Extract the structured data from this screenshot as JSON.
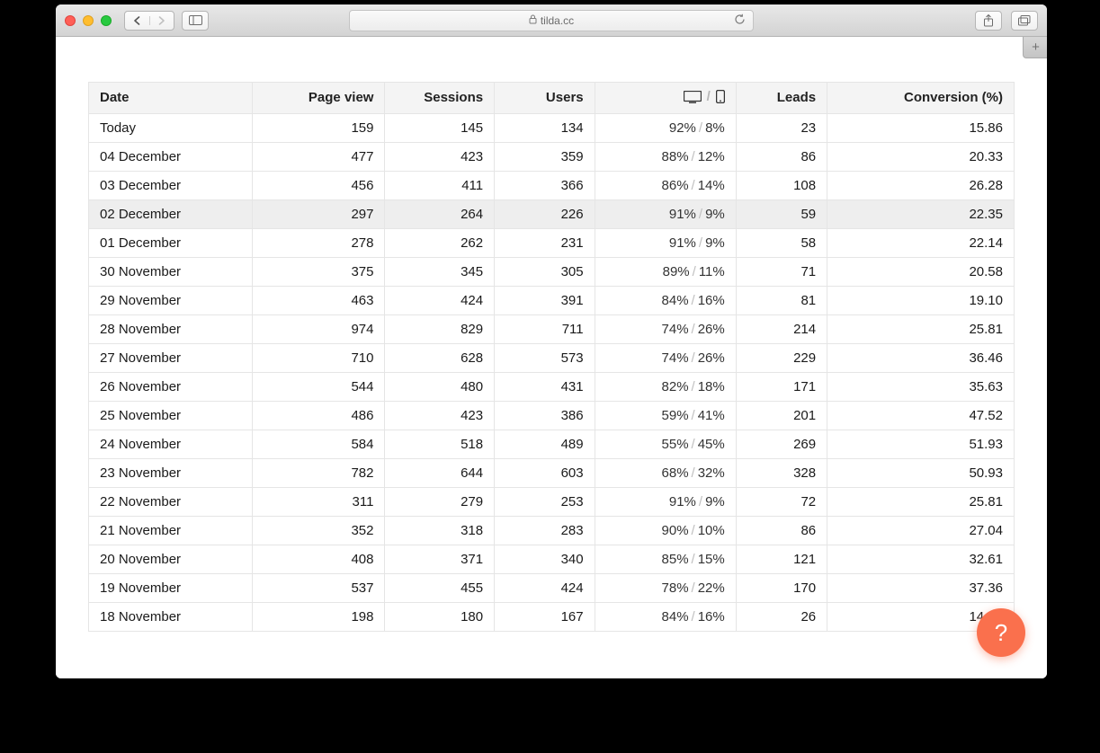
{
  "browser": {
    "url_host": "tilda.cc"
  },
  "table": {
    "headers": {
      "date": "Date",
      "page_view": "Page view",
      "sessions": "Sessions",
      "users": "Users",
      "leads": "Leads",
      "conversion": "Conversion (%)"
    },
    "rows": [
      {
        "date": "Today",
        "pv": "159",
        "sessions": "145",
        "users": "134",
        "desk": "92%",
        "mob": "8%",
        "leads": "23",
        "conv": "15.86",
        "hl": false
      },
      {
        "date": "04 December",
        "pv": "477",
        "sessions": "423",
        "users": "359",
        "desk": "88%",
        "mob": "12%",
        "leads": "86",
        "conv": "20.33",
        "hl": false
      },
      {
        "date": "03 December",
        "pv": "456",
        "sessions": "411",
        "users": "366",
        "desk": "86%",
        "mob": "14%",
        "leads": "108",
        "conv": "26.28",
        "hl": false
      },
      {
        "date": "02 December",
        "pv": "297",
        "sessions": "264",
        "users": "226",
        "desk": "91%",
        "mob": "9%",
        "leads": "59",
        "conv": "22.35",
        "hl": true
      },
      {
        "date": "01 December",
        "pv": "278",
        "sessions": "262",
        "users": "231",
        "desk": "91%",
        "mob": "9%",
        "leads": "58",
        "conv": "22.14",
        "hl": false
      },
      {
        "date": "30 November",
        "pv": "375",
        "sessions": "345",
        "users": "305",
        "desk": "89%",
        "mob": "11%",
        "leads": "71",
        "conv": "20.58",
        "hl": false
      },
      {
        "date": "29 November",
        "pv": "463",
        "sessions": "424",
        "users": "391",
        "desk": "84%",
        "mob": "16%",
        "leads": "81",
        "conv": "19.10",
        "hl": false
      },
      {
        "date": "28 November",
        "pv": "974",
        "sessions": "829",
        "users": "711",
        "desk": "74%",
        "mob": "26%",
        "leads": "214",
        "conv": "25.81",
        "hl": false
      },
      {
        "date": "27 November",
        "pv": "710",
        "sessions": "628",
        "users": "573",
        "desk": "74%",
        "mob": "26%",
        "leads": "229",
        "conv": "36.46",
        "hl": false
      },
      {
        "date": "26 November",
        "pv": "544",
        "sessions": "480",
        "users": "431",
        "desk": "82%",
        "mob": "18%",
        "leads": "171",
        "conv": "35.63",
        "hl": false
      },
      {
        "date": "25 November",
        "pv": "486",
        "sessions": "423",
        "users": "386",
        "desk": "59%",
        "mob": "41%",
        "leads": "201",
        "conv": "47.52",
        "hl": false
      },
      {
        "date": "24 November",
        "pv": "584",
        "sessions": "518",
        "users": "489",
        "desk": "55%",
        "mob": "45%",
        "leads": "269",
        "conv": "51.93",
        "hl": false
      },
      {
        "date": "23 November",
        "pv": "782",
        "sessions": "644",
        "users": "603",
        "desk": "68%",
        "mob": "32%",
        "leads": "328",
        "conv": "50.93",
        "hl": false
      },
      {
        "date": "22 November",
        "pv": "311",
        "sessions": "279",
        "users": "253",
        "desk": "91%",
        "mob": "9%",
        "leads": "72",
        "conv": "25.81",
        "hl": false
      },
      {
        "date": "21 November",
        "pv": "352",
        "sessions": "318",
        "users": "283",
        "desk": "90%",
        "mob": "10%",
        "leads": "86",
        "conv": "27.04",
        "hl": false
      },
      {
        "date": "20 November",
        "pv": "408",
        "sessions": "371",
        "users": "340",
        "desk": "85%",
        "mob": "15%",
        "leads": "121",
        "conv": "32.61",
        "hl": false
      },
      {
        "date": "19 November",
        "pv": "537",
        "sessions": "455",
        "users": "424",
        "desk": "78%",
        "mob": "22%",
        "leads": "170",
        "conv": "37.36",
        "hl": false
      },
      {
        "date": "18 November",
        "pv": "198",
        "sessions": "180",
        "users": "167",
        "desk": "84%",
        "mob": "16%",
        "leads": "26",
        "conv": "14.44",
        "hl": false
      }
    ]
  },
  "help_label": "?"
}
